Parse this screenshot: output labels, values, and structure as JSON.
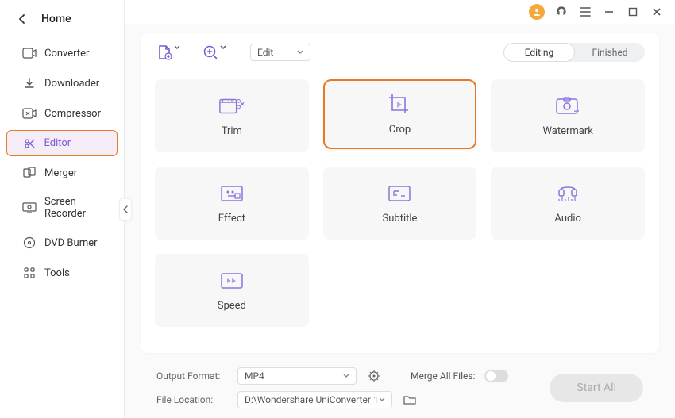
{
  "sidebar": {
    "title": "Home",
    "items": [
      {
        "label": "Converter"
      },
      {
        "label": "Downloader"
      },
      {
        "label": "Compressor"
      },
      {
        "label": "Editor"
      },
      {
        "label": "Merger"
      },
      {
        "label": "Screen Recorder"
      },
      {
        "label": "DVD Burner"
      },
      {
        "label": "Tools"
      }
    ]
  },
  "toolbar": {
    "mode_select": "Edit",
    "segmented": {
      "editing": "Editing",
      "finished": "Finished"
    }
  },
  "tiles": [
    {
      "label": "Trim"
    },
    {
      "label": "Crop"
    },
    {
      "label": "Watermark"
    },
    {
      "label": "Effect"
    },
    {
      "label": "Subtitle"
    },
    {
      "label": "Audio"
    },
    {
      "label": "Speed"
    }
  ],
  "bottombar": {
    "output_format_label": "Output Format:",
    "output_format_value": "MP4",
    "file_location_label": "File Location:",
    "file_location_value": "D:\\Wondershare UniConverter 1",
    "merge_label": "Merge All Files:",
    "start_button": "Start All"
  }
}
